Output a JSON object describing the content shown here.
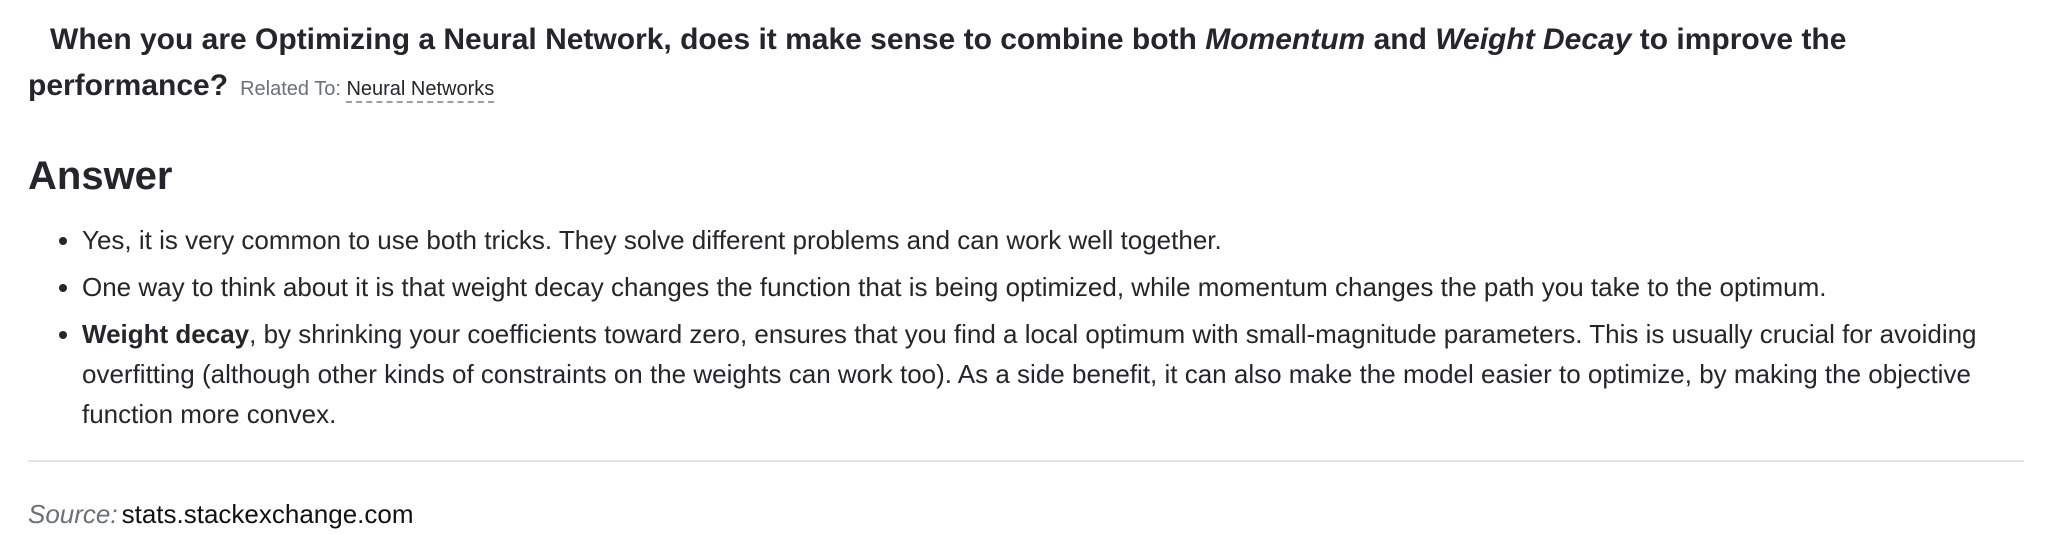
{
  "question": {
    "part1": "When you are Optimizing a Neural Network, does it make sense to combine both ",
    "term1": "Momentum",
    "part2": " and ",
    "term2": "Weight Decay",
    "part3": " to improve the performance?",
    "related_label": "Related To:",
    "related_link": "Neural Networks"
  },
  "answer": {
    "heading": "Answer",
    "items": [
      {
        "text": "Yes, it is very common to use both tricks. They solve different problems and can work well together."
      },
      {
        "text": "One way to think about it is that weight decay changes the function that is being optimized, while momentum changes the path you take to the optimum."
      },
      {
        "bold": "Weight decay",
        "text": ", by shrinking your coefficients toward zero, ensures that you find a local optimum with small-magnitude parameters. This is usually crucial for avoiding overfitting (although other kinds of constraints on the weights can work too). As a side benefit, it can also make the model easier to optimize, by making the objective function more convex."
      }
    ]
  },
  "source": {
    "label": "Source:",
    "value": "stats.stackexchange.com"
  }
}
